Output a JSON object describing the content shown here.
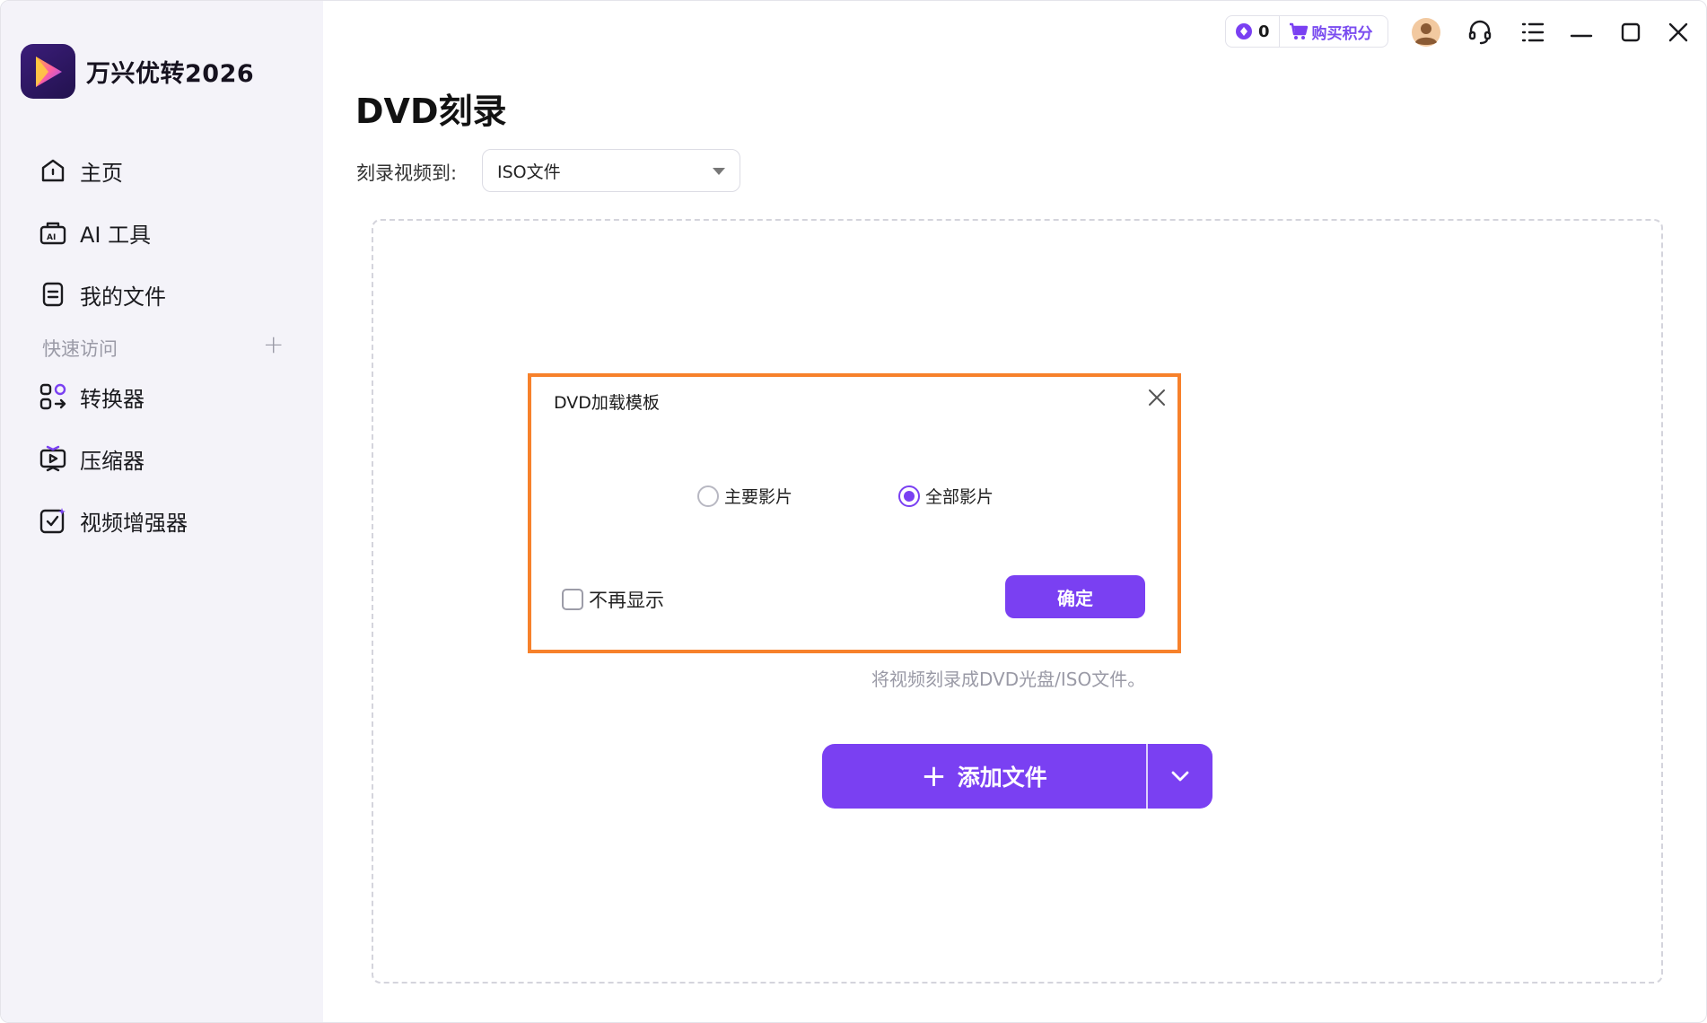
{
  "app": {
    "name": "万兴优转2026"
  },
  "sidebar": {
    "items": [
      {
        "label": "主页",
        "icon": "home-icon"
      },
      {
        "label": "AI 工具",
        "icon": "ai-toolbox-icon"
      },
      {
        "label": "我的文件",
        "icon": "file-icon"
      }
    ],
    "quick_access_label": "快速访问",
    "quick_add": "+",
    "quick_items": [
      {
        "label": "转换器",
        "icon": "converter-icon"
      },
      {
        "label": "压缩器",
        "icon": "compressor-icon"
      },
      {
        "label": "视频增强器",
        "icon": "video-enhancer-icon"
      }
    ]
  },
  "topbar": {
    "points_count": "0",
    "buy_points_label": "购买积分"
  },
  "main": {
    "title": "DVD刻录",
    "burn_to_label": "刻录视频到:",
    "burn_target_value": "ISO文件",
    "hint": "将视频刻录成DVD光盘/ISO文件。",
    "add_files_label": "添加文件"
  },
  "dialog": {
    "title": "DVD加载模板",
    "options": [
      {
        "label": "主要影片",
        "selected": false
      },
      {
        "label": "全部影片",
        "selected": true
      }
    ],
    "dont_show_label": "不再显示",
    "dont_show_checked": false,
    "confirm_label": "确定"
  },
  "colors": {
    "accent": "#7a40f2",
    "highlight_outline": "#f7812b",
    "sidebar_bg": "#f4f3f9"
  }
}
